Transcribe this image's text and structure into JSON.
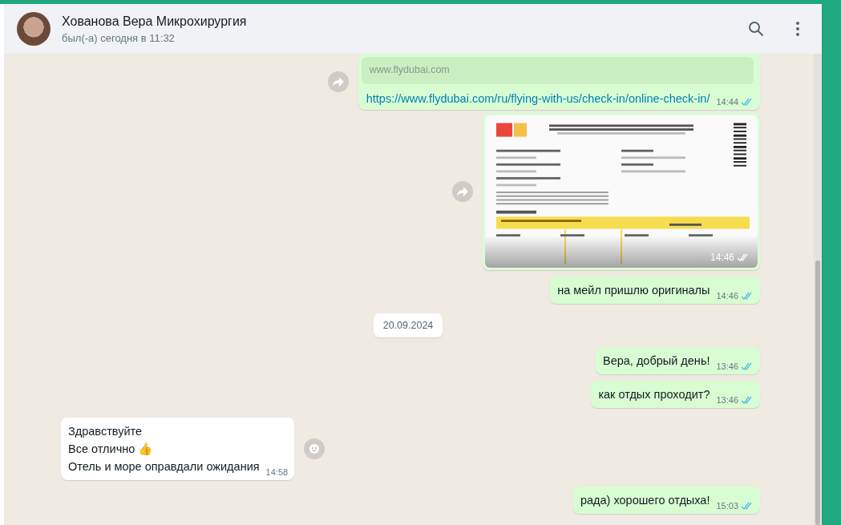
{
  "header": {
    "name": "Хованова Вера Микрохирургия",
    "status": "был(-а) сегодня в 11:32"
  },
  "messages": [
    {
      "kind": "link",
      "outgoing": true,
      "forward": true,
      "preview_site": "www.flydubai.com",
      "url": "https://www.flydubai.com/ru/flying-with-us/check-in/online-check-in/",
      "time": "14:44",
      "read": true
    },
    {
      "kind": "image",
      "outgoing": true,
      "forward": true,
      "time": "14:46",
      "read": true
    },
    {
      "kind": "text",
      "outgoing": true,
      "lines": [
        "на мейл пришлю оригиналы"
      ],
      "time": "14:46",
      "read": true
    },
    {
      "kind": "date",
      "label": "20.09.2024"
    },
    {
      "kind": "text",
      "outgoing": true,
      "lines": [
        "Вера, добрый день!"
      ],
      "time": "13:46",
      "read": true
    },
    {
      "kind": "text",
      "outgoing": true,
      "lines": [
        "как отдых проходит?"
      ],
      "time": "13:46",
      "read": true
    },
    {
      "kind": "text",
      "outgoing": false,
      "react": true,
      "lines": [
        "Здравствуйте",
        "Все отлично 👍",
        "Отель и море оправдали ожидания"
      ],
      "time": "14:58"
    },
    {
      "kind": "text",
      "outgoing": true,
      "lines": [
        "рада) хорошего отдыха!"
      ],
      "time": "15:03",
      "read": true
    }
  ]
}
